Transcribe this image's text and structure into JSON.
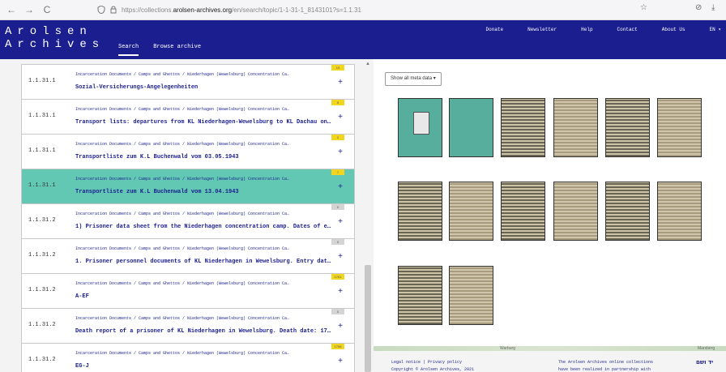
{
  "browser": {
    "url_prefix": "https://collections.",
    "url_domain": "arolsen-archives.org",
    "url_path": "/en/search/topic/1-1-31-1_8143101?s=1.1.31",
    "back_icon": "←",
    "forward_icon": "→",
    "reload_icon": "C",
    "bookmark_icon": "☆",
    "pocket_icon": "⊘",
    "download_icon": "⤓"
  },
  "header": {
    "logo_line1": "Arolsen",
    "logo_line2": "Archives",
    "nav": [
      "Search",
      "Browse archive"
    ],
    "right_links": [
      "Donate",
      "Newsletter",
      "Help",
      "Contact",
      "About Us"
    ],
    "lang": "EN ▾"
  },
  "list": [
    {
      "id": "1.1.31.1",
      "path": "Incarceration Documents / Camps and Ghettos / Niederhagen (Wewelsburg) Concentration Ca…",
      "title": "Sozial-Versicherungs-Angelegenheiten",
      "count": "19",
      "badge": "yellow"
    },
    {
      "id": "1.1.31.1",
      "path": "Incarceration Documents / Camps and Ghettos / Niederhagen (Wewelsburg) Concentration Ca…",
      "title": "Transport lists: departures from KL Niederhagen-Wewelsburg to KL Dachau on…",
      "count": "5",
      "badge": "yellow"
    },
    {
      "id": "1.1.31.1",
      "path": "Incarceration Documents / Camps and Ghettos / Niederhagen (Wewelsburg) Concentration Ca…",
      "title": "Transportliste zum K.L Buchenwald vom 03.05.1943",
      "count": "2",
      "badge": "yellow"
    },
    {
      "id": "1.1.31.1",
      "path": "Incarceration Documents / Camps and Ghettos / Niederhagen (Wewelsburg) Concentration Ca…",
      "title": "Transportliste zum K.L Buchenwald vom 13.04.1943",
      "count": "7",
      "badge": "yellow",
      "selected": true
    },
    {
      "id": "1.1.31.2",
      "path": "Incarceration Documents / Camps and Ghettos / Niederhagen (Wewelsburg) Concentration Ca…",
      "title": "1) Prisoner data sheet from the Niederhagen concentration camp. Dates of e…",
      "count": "0",
      "badge": "grey"
    },
    {
      "id": "1.1.31.2",
      "path": "Incarceration Documents / Camps and Ghettos / Niederhagen (Wewelsburg) Concentration Ca…",
      "title": "1. Prisoner personnel documents of KL Niederhagen in Wewelsburg. Entry dat…",
      "count": "0",
      "badge": "grey"
    },
    {
      "id": "1.1.31.2",
      "path": "Incarceration Documents / Camps and Ghettos / Niederhagen (Wewelsburg) Concentration Ca…",
      "title": "A-EF",
      "count": "1761",
      "badge": "yellow"
    },
    {
      "id": "1.1.31.2",
      "path": "Incarceration Documents / Camps and Ghettos / Niederhagen (Wewelsburg) Concentration Ca…",
      "title": "Death report of a prisoner of KL Niederhagen in Wewelsburg. Death date: 17…",
      "count": "0",
      "badge": "grey"
    },
    {
      "id": "1.1.31.2",
      "path": "Incarceration Documents / Camps and Ghettos / Niederhagen (Wewelsburg) Concentration Ca…",
      "title": "EG-J",
      "count": "1758",
      "badge": "yellow"
    }
  ],
  "viewer": {
    "meta_button": "Show all meta data ▾",
    "map_label_left": "Warburg",
    "map_label_right": "Marsberg"
  },
  "footer": {
    "links": "Legal notice  |  Privacy policy",
    "copyright": "Copyright © Arolsen Archives, 2021",
    "partner_line1": "The Arolsen Archives online collections",
    "partner_line2": "have been realized in partnership with",
    "partner_logo": "יד ושם"
  },
  "colors": {
    "header_bg": "#1a1e8e",
    "selected_row": "#62c8b3",
    "badge_yellow": "#f2d51e",
    "doc_green": "#58ae9d"
  }
}
